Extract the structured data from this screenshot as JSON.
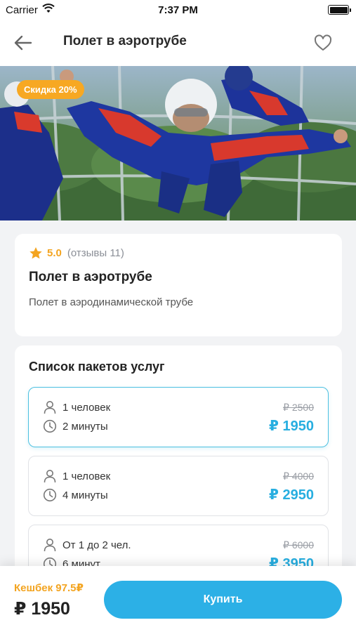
{
  "status_bar": {
    "carrier": "Carrier",
    "time": "7:37 PM"
  },
  "nav": {
    "title": "Полет в аэротрубе",
    "back_icon": "arrow-left-icon",
    "fav_icon": "heart-icon"
  },
  "hero": {
    "discount": "Скидка 20%"
  },
  "info": {
    "rating": "5.0",
    "reviews": "(отзывы 11)",
    "title": "Полет в аэротрубе",
    "description": "Полет в аэродинамической трубе"
  },
  "packages": {
    "title": "Список пакетов услуг",
    "items": [
      {
        "people": "1 человек",
        "duration": "2 минуты",
        "old_price": "₽ 2500",
        "price": "₽ 1950",
        "selected": true
      },
      {
        "people": "1 человек",
        "duration": "4 минуты",
        "old_price": "₽ 4000",
        "price": "₽ 2950",
        "selected": false
      },
      {
        "people": "От 1 до 2 чел.",
        "duration": "6 минут",
        "old_price": "₽ 6000",
        "price": "₽ 3950",
        "selected": false
      }
    ]
  },
  "bottom": {
    "cashback": "Кешбек 97.5₽",
    "total": "₽ 1950",
    "buy_label": "Купить"
  },
  "colors": {
    "accent": "#2cb0e6",
    "orange": "#f3a420",
    "selected_border": "#4cc0e0"
  }
}
